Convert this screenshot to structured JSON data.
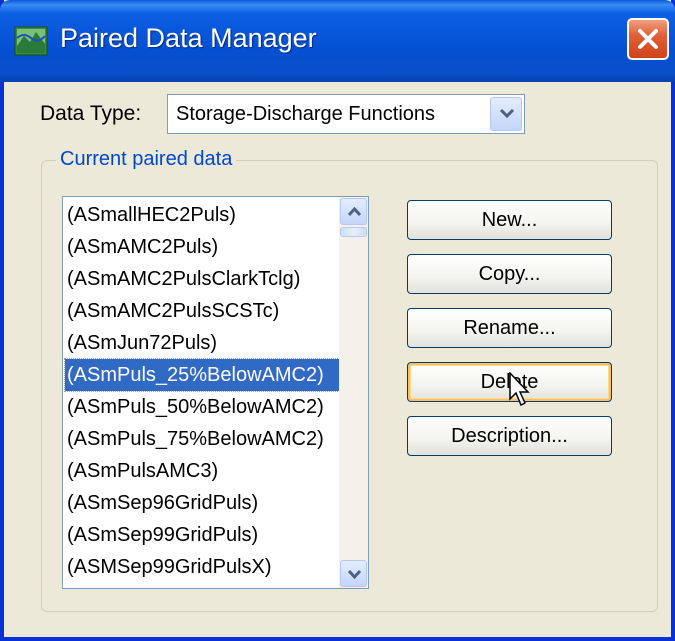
{
  "window": {
    "title": "Paired Data Manager",
    "icon": "paired-data-app-icon",
    "close_icon": "close-icon"
  },
  "data_type": {
    "label": "Data Type:",
    "selected": "Storage-Discharge Functions"
  },
  "group": {
    "label": "Current paired data",
    "items": [
      "(ASmallHEC2Puls)",
      "(ASmAMC2Puls)",
      "(ASmAMC2PulsClarkTclg)",
      "(ASmAMC2PulsSCSTc)",
      "(ASmJun72Puls)",
      "(ASmPuls_25%BelowAMC2)",
      "(ASmPuls_50%BelowAMC2)",
      "(ASmPuls_75%BelowAMC2)",
      "(ASmPulsAMC3)",
      "(ASmSep96GridPuls)",
      "(ASmSep99GridPuls)",
      "(ASMSep99GridPulsX)"
    ],
    "selected_index": 5
  },
  "buttons": {
    "new": "New...",
    "copy": "Copy...",
    "rename": "Rename...",
    "delete": "Delete",
    "description": "Description..."
  },
  "colors": {
    "title_bar": "#0450d3",
    "selection": "#316ac5",
    "group_label": "#0046d5",
    "close_button": "#d0421a"
  }
}
